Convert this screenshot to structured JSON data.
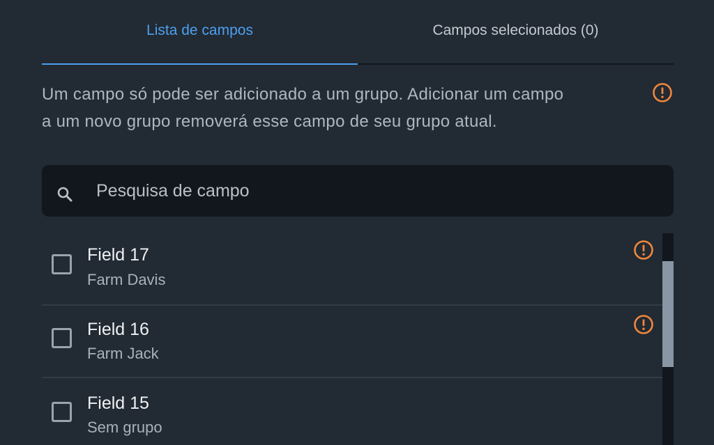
{
  "tabs": [
    {
      "label": "Lista de campos",
      "active": true
    },
    {
      "label": "Campos selecionados (0)",
      "active": false
    }
  ],
  "info": {
    "line1": "Um campo só pode ser adicionado a um grupo. Adicionar um campo",
    "line2": "a um novo grupo removerá esse campo de seu grupo atual.",
    "icon": "warning-circle-icon"
  },
  "search": {
    "placeholder": "Pesquisa de campo",
    "value": "",
    "icon": "search-icon"
  },
  "fields": [
    {
      "name": "Field 17",
      "group": "Farm Davis",
      "checked": false,
      "warning": true
    },
    {
      "name": "Field 16",
      "group": "Farm Jack",
      "checked": false,
      "warning": true
    },
    {
      "name": "Field 15",
      "group": "Sem grupo",
      "checked": false,
      "warning": false
    }
  ],
  "colors": {
    "background": "#222a33",
    "accent": "#4da0f0",
    "warning": "#f0873c",
    "search_bg": "#12171d"
  }
}
